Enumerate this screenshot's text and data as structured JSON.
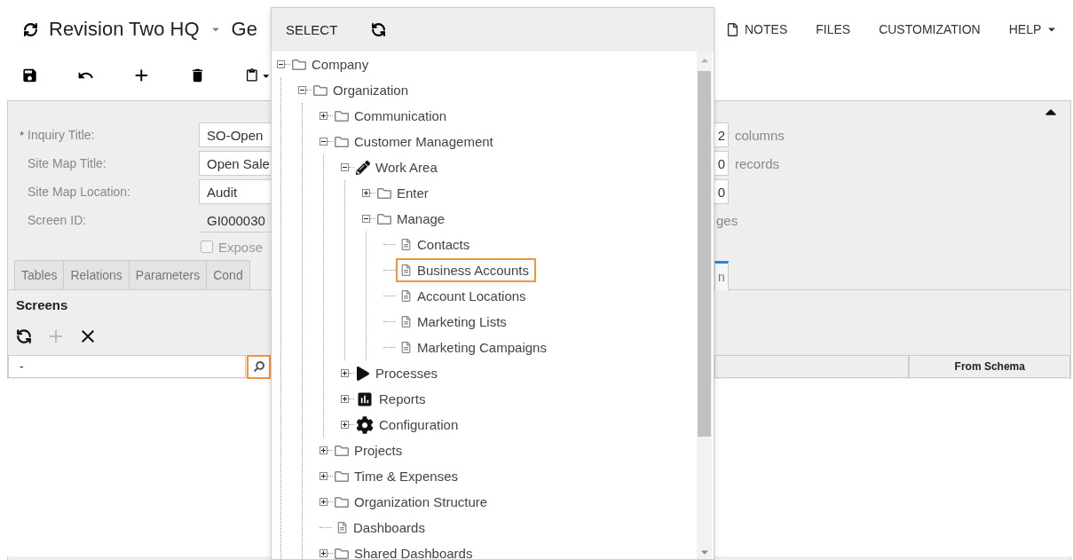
{
  "header": {
    "title": "Revision Two HQ",
    "title_cut": "Ge",
    "links": [
      {
        "label": "NOTES",
        "kind": "notes"
      },
      {
        "label": "FILES",
        "kind": "plain"
      },
      {
        "label": "CUSTOMIZATION",
        "kind": "plain"
      },
      {
        "label": "HELP",
        "kind": "menu"
      }
    ]
  },
  "form": {
    "fields": [
      {
        "marker": "*",
        "label": "Inquiry Title:",
        "value": "SO-Open",
        "kind": "input"
      },
      {
        "label": "Site Map Title:",
        "value": "Open Sale",
        "kind": "input"
      },
      {
        "label": "Site Map Location:",
        "value": "Audit",
        "kind": "input"
      },
      {
        "label": "Screen ID:",
        "value": "GI000030",
        "kind": "readonly"
      }
    ],
    "checkbox": {
      "label": "Expose",
      "checked": false
    },
    "right_fields": [
      {
        "value": "2",
        "unit": "columns"
      },
      {
        "value": "0",
        "unit": "records"
      },
      {
        "value": "0"
      }
    ],
    "right_note": "ges"
  },
  "tabs": {
    "left": [
      {
        "label": "Tables",
        "selected": false
      },
      {
        "label": "Relations",
        "selected": false
      },
      {
        "label": "Parameters",
        "selected": false
      },
      {
        "label": "Cond",
        "selected": false
      }
    ],
    "right": [
      {
        "label": "n",
        "selected": true
      }
    ]
  },
  "screens": {
    "title": "Screens",
    "tools": [
      {
        "kind": "refresh",
        "disabled": false
      },
      {
        "kind": "add",
        "disabled": true
      },
      {
        "kind": "delete",
        "disabled": false
      }
    ],
    "filter": {
      "value": "-"
    },
    "columns": [
      {
        "label": "From Schema"
      }
    ]
  },
  "popup": {
    "title": "SELECT",
    "tree": [
      {
        "label": "Company",
        "kind": "folder",
        "expanded": true,
        "selected": false,
        "children": [
          {
            "label": "Organization",
            "kind": "folder",
            "expanded": true,
            "selected": false,
            "children": [
              {
                "label": "Communication",
                "kind": "folder",
                "expanded": false,
                "selected": false
              },
              {
                "label": "Customer Management",
                "kind": "folder",
                "expanded": true,
                "selected": false,
                "children": [
                  {
                    "label": "Work Area",
                    "kind": "edit",
                    "expanded": true,
                    "selected": false,
                    "children": [
                      {
                        "label": "Enter",
                        "kind": "folder",
                        "expanded": false,
                        "selected": false
                      },
                      {
                        "label": "Manage",
                        "kind": "folder",
                        "expanded": true,
                        "selected": false,
                        "children": [
                          {
                            "label": "Contacts",
                            "kind": "page",
                            "selected": false
                          },
                          {
                            "label": "Business Accounts",
                            "kind": "page",
                            "selected": true
                          },
                          {
                            "label": "Account Locations",
                            "kind": "page",
                            "selected": false
                          },
                          {
                            "label": "Marketing Lists",
                            "kind": "page",
                            "selected": false
                          },
                          {
                            "label": "Marketing Campaigns",
                            "kind": "page",
                            "selected": false
                          }
                        ]
                      }
                    ]
                  },
                  {
                    "label": "Processes",
                    "kind": "play",
                    "expanded": false,
                    "selected": false
                  },
                  {
                    "label": "Reports",
                    "kind": "chart",
                    "expanded": false,
                    "selected": false
                  },
                  {
                    "label": "Configuration",
                    "kind": "gear",
                    "expanded": false,
                    "selected": false
                  }
                ]
              },
              {
                "label": "Projects",
                "kind": "folder",
                "expanded": false,
                "selected": false
              },
              {
                "label": "Time & Expenses",
                "kind": "folder",
                "expanded": false,
                "selected": false
              },
              {
                "label": "Organization Structure",
                "kind": "folder",
                "expanded": false,
                "selected": false
              },
              {
                "label": "Dashboards",
                "kind": "page",
                "selected": false
              },
              {
                "label": "Shared Dashboards",
                "kind": "folder",
                "expanded": false,
                "selected": false
              }
            ]
          }
        ]
      }
    ]
  }
}
